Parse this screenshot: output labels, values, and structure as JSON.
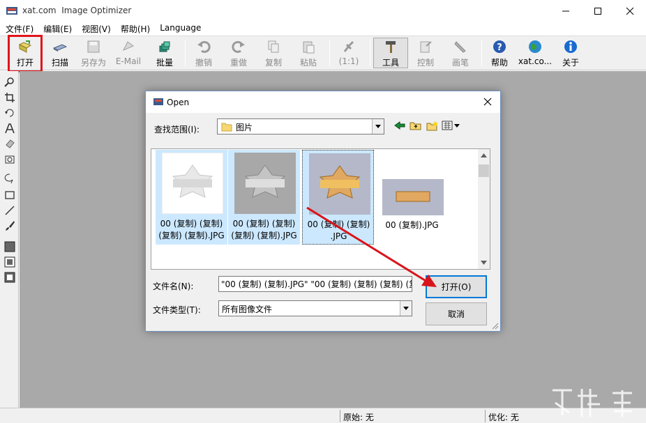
{
  "window": {
    "title": "xat.com  Image Optimizer"
  },
  "menu": [
    "文件(F)",
    "编辑(E)",
    "视图(V)",
    "帮助(H)",
    "Language"
  ],
  "toolbar": {
    "open": "打开",
    "scan": "扫描",
    "save_as": "另存为",
    "email": "E-Mail",
    "batch": "批量",
    "undo": "撤销",
    "redo": "重做",
    "copy": "复制",
    "paste": "粘贴",
    "zoom": "(1:1)",
    "tools": "工具",
    "control": "控制",
    "brush": "画笔",
    "help": "帮助",
    "xat": "xat.co...",
    "about": "关于"
  },
  "statusbar": {
    "original": "原始: 无",
    "optimized": "优化: 无"
  },
  "dialog": {
    "title": "Open",
    "look_in_label": "查找范围(I):",
    "look_in_value": "图片",
    "files": [
      {
        "name": "00 (复制) (复制) (复制) (复制).JPG"
      },
      {
        "name": "00 (复制) (复制) (复制) (复制).JPG"
      },
      {
        "name": "00 (复制) (复制) .JPG"
      },
      {
        "name": "00 (复制).JPG"
      }
    ],
    "filename_label": "文件名(N):",
    "filename_value": "\"00 (复制) (复制).JPG\" \"00 (复制) (复制) (复制) (复",
    "filetype_label": "文件类型(T):",
    "filetype_value": "所有图像文件",
    "open_button": "打开(O)",
    "cancel_button": "取消"
  },
  "colors": {
    "highlight": "#e2141b",
    "selection": "#cce8ff",
    "workspace": "#a9a9a9"
  }
}
